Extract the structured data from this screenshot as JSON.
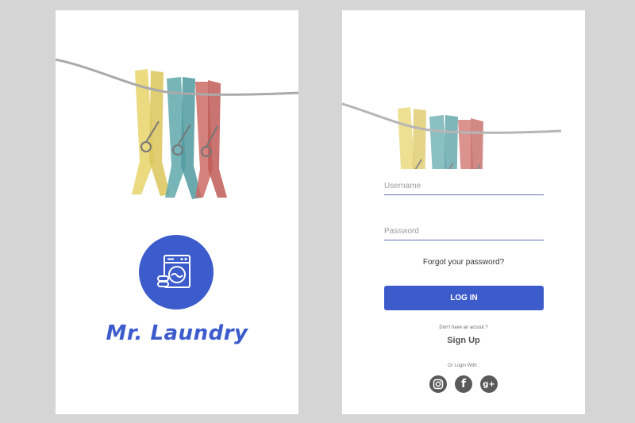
{
  "splash": {
    "app_name": "Mr. Laundry",
    "logo_icon": "washing-machine-icon",
    "colors": {
      "brand": "#3d5ccc",
      "peg_yellow": "#e8d36a",
      "peg_teal": "#5fa8ad",
      "peg_red": "#cc6a64"
    }
  },
  "login": {
    "username_placeholder": "Username",
    "password_placeholder": "Password",
    "forgot_label": "Forgot your password?",
    "login_label": "LOG IN",
    "no_account_text": "Don't have an accout ?",
    "signup_label": "Sign Up",
    "or_login_text": "Or Login With :",
    "social_icons": [
      "instagram-icon",
      "facebook-icon",
      "google-plus-icon"
    ]
  }
}
